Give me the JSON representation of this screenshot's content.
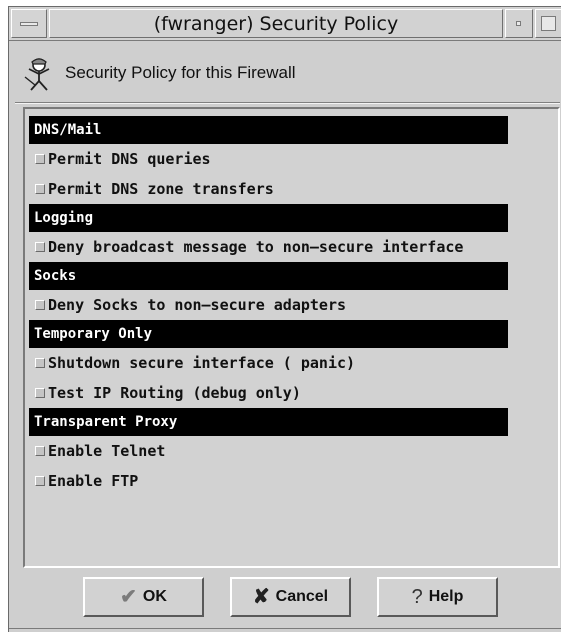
{
  "window": {
    "title": "(fwranger) Security Policy"
  },
  "header": {
    "icon": "security-guard-icon",
    "label": "Security Policy for this Firewall"
  },
  "sections": [
    {
      "title": "DNS/Mail",
      "options": [
        {
          "label": "Permit DNS queries",
          "checked": false
        },
        {
          "label": "Permit DNS zone transfers",
          "checked": false
        }
      ]
    },
    {
      "title": "Logging",
      "options": [
        {
          "label": "Deny broadcast message to non–secure interface",
          "checked": false
        }
      ]
    },
    {
      "title": "Socks",
      "options": [
        {
          "label": "Deny Socks to non–secure adapters",
          "checked": false
        }
      ]
    },
    {
      "title": "Temporary Only",
      "options": [
        {
          "label": "Shutdown secure interface ( panic)",
          "checked": false
        },
        {
          "label": "Test IP Routing (debug only)",
          "checked": false
        }
      ]
    },
    {
      "title": "Transparent Proxy",
      "options": [
        {
          "label": "Enable Telnet",
          "checked": false
        },
        {
          "label": "Enable FTP",
          "checked": false
        }
      ]
    }
  ],
  "buttons": {
    "ok": {
      "label": "OK",
      "icon": "checkmark-icon"
    },
    "cancel": {
      "label": "Cancel",
      "icon": "x-mark-icon"
    },
    "help": {
      "label": "Help",
      "icon": "question-mark-icon"
    }
  }
}
